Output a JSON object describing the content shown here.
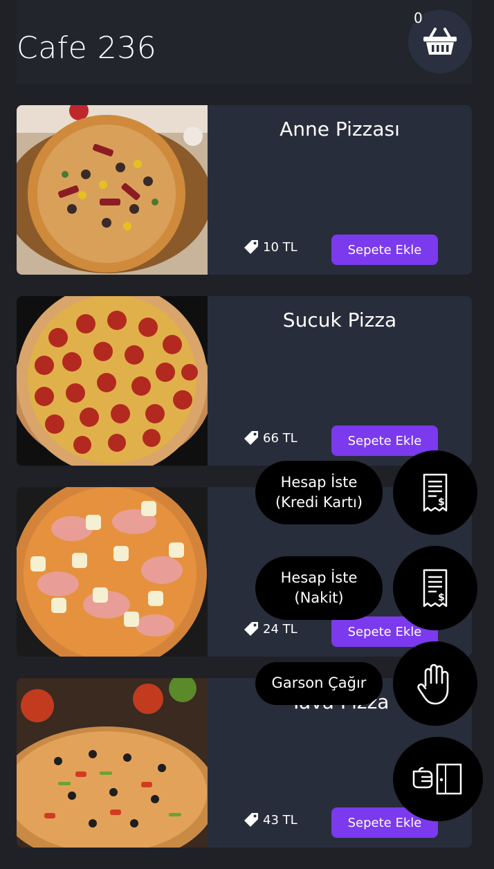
{
  "header": {
    "title": "Cafe 236",
    "cart_count": "0"
  },
  "menu": {
    "add_label": "Sepete Ekle",
    "items": [
      {
        "name": "Anne Pizzası",
        "price": "10 TL"
      },
      {
        "name": "Sucuk Pizza",
        "price": "66 TL"
      },
      {
        "name": "",
        "price": "24 TL"
      },
      {
        "name": "Tava Pizza",
        "price": "43 TL"
      }
    ]
  },
  "actions": {
    "card_bill": {
      "line1": "Hesap İste",
      "line2": "(Kredi Kartı)"
    },
    "cash_bill": {
      "line1": "Hesap İste",
      "line2": "(Nakit)"
    },
    "waiter": {
      "label": "Garson Çağır"
    }
  },
  "colors": {
    "accent": "#7b3aed",
    "card": "#282d3b",
    "background": "#1f2127"
  }
}
